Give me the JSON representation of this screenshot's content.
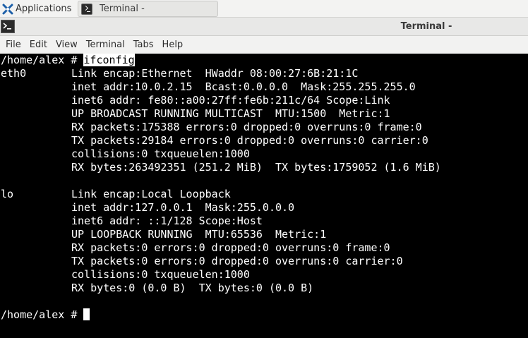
{
  "taskbar": {
    "apps_label": "Applications",
    "apps_icon": "xfce-logo-icon",
    "task_title": "Terminal -",
    "task_icon": "terminal-icon"
  },
  "window": {
    "title": "Terminal -",
    "icon": "terminal-icon"
  },
  "menu": {
    "items": [
      "File",
      "Edit",
      "View",
      "Terminal",
      "Tabs",
      "Help"
    ]
  },
  "terminal": {
    "prompt": "/home/alex # ",
    "command": "ifconfig",
    "interfaces": [
      {
        "name": "eth0",
        "lines": [
          "Link encap:Ethernet  HWaddr 08:00:27:6B:21:1C",
          "inet addr:10.0.2.15  Bcast:0.0.0.0  Mask:255.255.255.0",
          "inet6 addr: fe80::a00:27ff:fe6b:211c/64 Scope:Link",
          "UP BROADCAST RUNNING MULTICAST  MTU:1500  Metric:1",
          "RX packets:175388 errors:0 dropped:0 overruns:0 frame:0",
          "TX packets:29184 errors:0 dropped:0 overruns:0 carrier:0",
          "collisions:0 txqueuelen:1000",
          "RX bytes:263492351 (251.2 MiB)  TX bytes:1759052 (1.6 MiB)"
        ]
      },
      {
        "name": "lo",
        "lines": [
          "Link encap:Local Loopback",
          "inet addr:127.0.0.1  Mask:255.0.0.0",
          "inet6 addr: ::1/128 Scope:Host",
          "UP LOOPBACK RUNNING  MTU:65536  Metric:1",
          "RX packets:0 errors:0 dropped:0 overruns:0 frame:0",
          "TX packets:0 errors:0 dropped:0 overruns:0 carrier:0",
          "collisions:0 txqueuelen:1000",
          "RX bytes:0 (0.0 B)  TX bytes:0 (0.0 B)"
        ]
      }
    ],
    "final_prompt": "/home/alex # "
  }
}
